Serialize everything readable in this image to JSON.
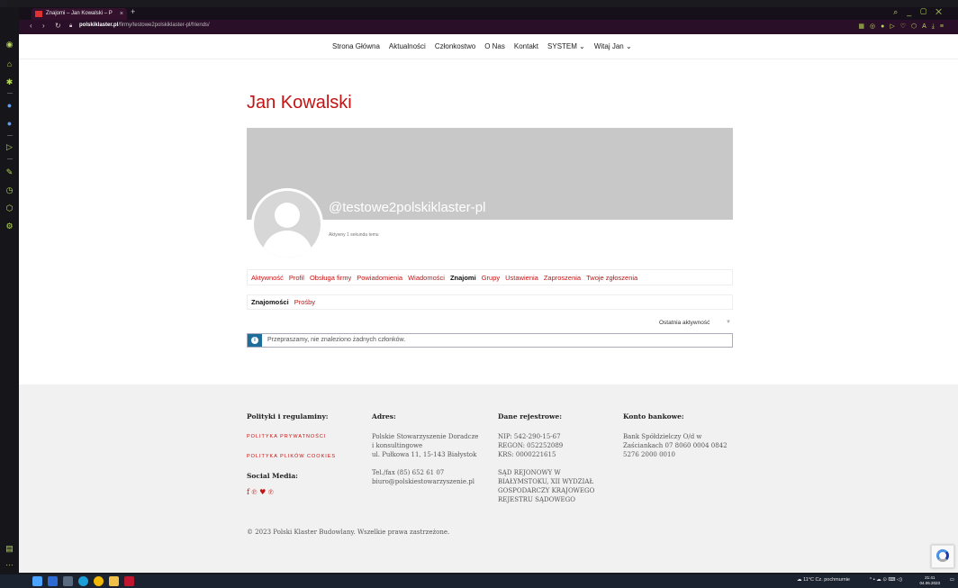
{
  "browser": {
    "tab_title": "Znajomi – Jan Kowalski – P",
    "url_domain": "polskiklaster.pl",
    "url_path": "/firmy/testowe2polskiklaster-pl/friends/"
  },
  "nav": {
    "items": [
      "Strona Główna",
      "Aktualności",
      "Członkostwo",
      "O Nas",
      "Kontakt",
      "SYSTEM ⌄",
      "Witaj Jan ⌄"
    ]
  },
  "profile": {
    "name": "Jan Kowalski",
    "username": "@testowe2polskiklaster-pl",
    "last_active": "Aktywny 1 sekunda temu"
  },
  "subnav": {
    "items": [
      "Aktywność",
      "Profil",
      "Obsługa firmy",
      "Powiadomienia",
      "Wiadomości",
      "Znajomi",
      "Grupy",
      "Ustawienia",
      "Zaproszenia",
      "Twoje zgłoszenia"
    ],
    "active": "Znajomi"
  },
  "friendnav": {
    "items": [
      "Znajomości",
      "Prośby"
    ],
    "active": "Znajomości"
  },
  "order": {
    "selected": "Ostatnia aktywność"
  },
  "notice": {
    "text": "Przepraszamy, nie znaleziono żadnych członków."
  },
  "footer": {
    "policies": {
      "heading": "Polityki i regulaminy:",
      "privacy": "POLITYKA PRYWATNOŚCI",
      "cookies": "POLITYKA PLIKÓW COOKIES",
      "social_heading": "Social Media:"
    },
    "address": {
      "heading": "Adres:",
      "line1": "Polskie Stowarzyszenie Doradcze",
      "line2": "i konsultingowe",
      "line3": "ul. Pułkowa 11, 15-143 Białystok",
      "phone": "Tel./fax (85) 652 61 07",
      "email": "biuro@polskiestowarzyszenie.pl"
    },
    "registry": {
      "heading": "Dane rejestrowe:",
      "nip": "NIP: 542-290-15-67",
      "regon": "REGON: 052252089",
      "krs": "KRS: 0000221615",
      "court1": "SĄD REJONOWY W",
      "court2": "BIAŁYMSTOKU, XII WYDZIAŁ",
      "court3": "GOSPODARCZY KRAJOWEGO",
      "court4": "REJESTRU SĄDOWEGO"
    },
    "bank": {
      "heading": "Konto bankowe:",
      "line1": "Bank Spółdzielczy O/d w",
      "line2": "Zaściankach 07 8060 0004 0842",
      "line3": "5276 2000 0010"
    },
    "copyright": "© 2023 Polski Klaster Budowlany. Wszelkie prawa zastrzeżone."
  },
  "taskbar": {
    "weather": "11°C  Cz. pochmurnie",
    "time": "21:41",
    "date": "04.06.2023"
  },
  "colors": {
    "accent": "#c51212",
    "cover": "#c8c8c8",
    "notice_icon": "#1e6e9c"
  }
}
